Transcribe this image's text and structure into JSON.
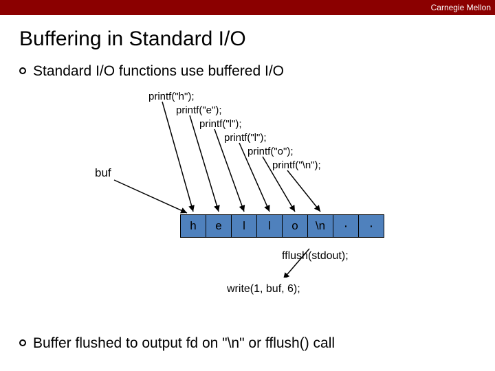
{
  "brand": "Carnegie Mellon",
  "title": "Buffering in Standard I/O",
  "bullets": {
    "top": "Standard I/O functions use buffered I/O",
    "bottom": "Buffer flushed to output fd on \"\\n\" or fflush() call"
  },
  "labels": {
    "buf": "buf",
    "fflush": "fflush(stdout);",
    "write": "write(1, buf, 6);"
  },
  "printf_calls": [
    "printf(\"h\");",
    "printf(\"e\");",
    "printf(\"l\");",
    "printf(\"l\");",
    "printf(\"o\");",
    "printf(\"\\n\");"
  ],
  "cells": [
    "h",
    "e",
    "l",
    "l",
    "o",
    "\\n",
    "·",
    "·"
  ]
}
